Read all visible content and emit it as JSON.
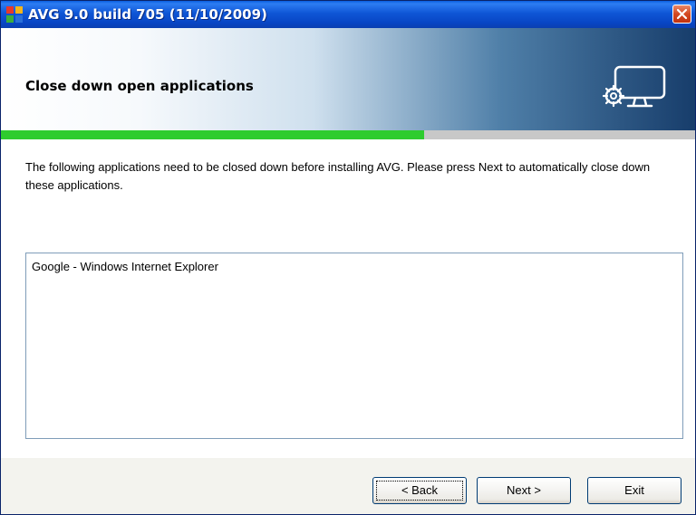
{
  "window": {
    "title": "AVG 9.0 build 705 (11/10/2009)"
  },
  "header": {
    "title": "Close down open applications",
    "icon": "computer-settings-icon"
  },
  "progress": {
    "fraction": 0.61,
    "fill_color": "#2ecc2e",
    "track_color": "#c8c8c8"
  },
  "content": {
    "instructions": "The following applications need to be closed down before installing AVG. Please press Next to automatically close down these applications.",
    "applications": [
      "Google - Windows Internet Explorer"
    ]
  },
  "buttons": {
    "back": "< Back",
    "next": "Next >",
    "exit": "Exit"
  },
  "colors": {
    "titlebar": "#0a54d4",
    "close_button": "#d3471f"
  }
}
